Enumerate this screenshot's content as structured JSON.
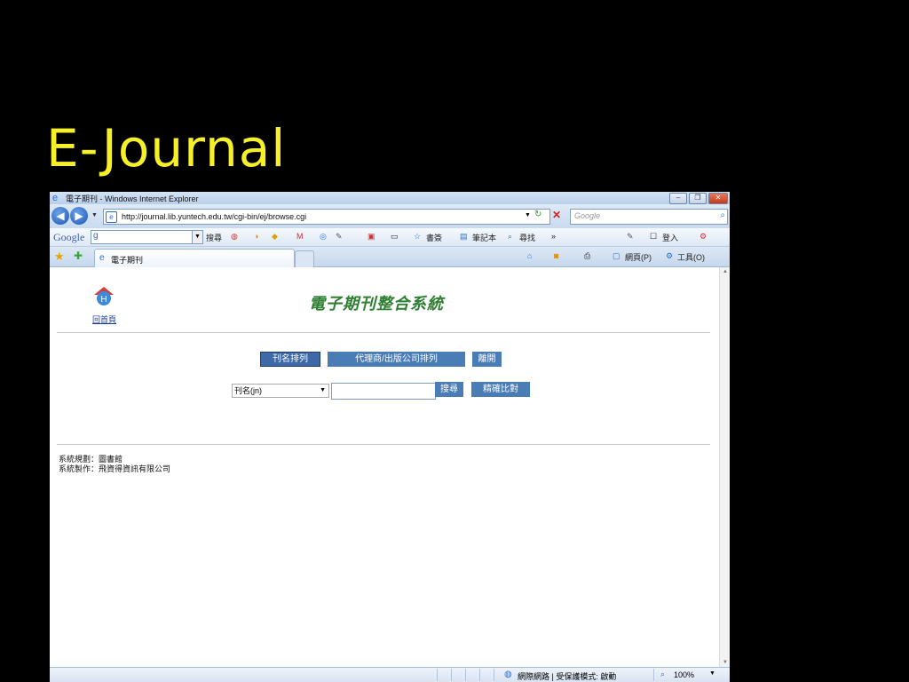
{
  "slide": {
    "title": "E-Journal"
  },
  "window": {
    "title": "電子期刊 - Windows Internet Explorer",
    "buttons": {
      "minimize": "–",
      "maximize": "❐",
      "close": "✕"
    }
  },
  "address_bar": {
    "url": "http://journal.lib.yuntech.edu.tw/cgi-bin/ej/browse.cgi",
    "search_placeholder": "Google"
  },
  "google_toolbar": {
    "logo": "Google",
    "query": "g",
    "search_label": "搜尋",
    "bookmarks_label": "書簽",
    "notebook_label": "筆記本",
    "find_label": "尋找",
    "more": "»",
    "signin_label": "登入"
  },
  "tab_bar": {
    "active_tab_label": "電子期刊",
    "page_menu": "網頁(P)",
    "tools_menu": "工具(O)"
  },
  "page": {
    "home_link": "回首頁",
    "site_title": "電子期刊整合系統",
    "nav": {
      "by_title": "刊名排列",
      "by_vendor": "代理商/出版公司排列",
      "exit": "離開"
    },
    "search": {
      "field_value": "刊名(jn)",
      "keyword": "",
      "search_button": "搜尋",
      "exact_button": "精確比對"
    },
    "footer": {
      "planning": "系統規劃：圖書館",
      "production": "系統製作：飛資得資訊有限公司"
    }
  },
  "status_bar": {
    "zone": "網際網路 | 受保護模式: 啟動",
    "zoom": "100%"
  },
  "colors": {
    "slide_title": "#f5f028",
    "site_title": "#2e7f32",
    "button": "#4a7cb5"
  }
}
